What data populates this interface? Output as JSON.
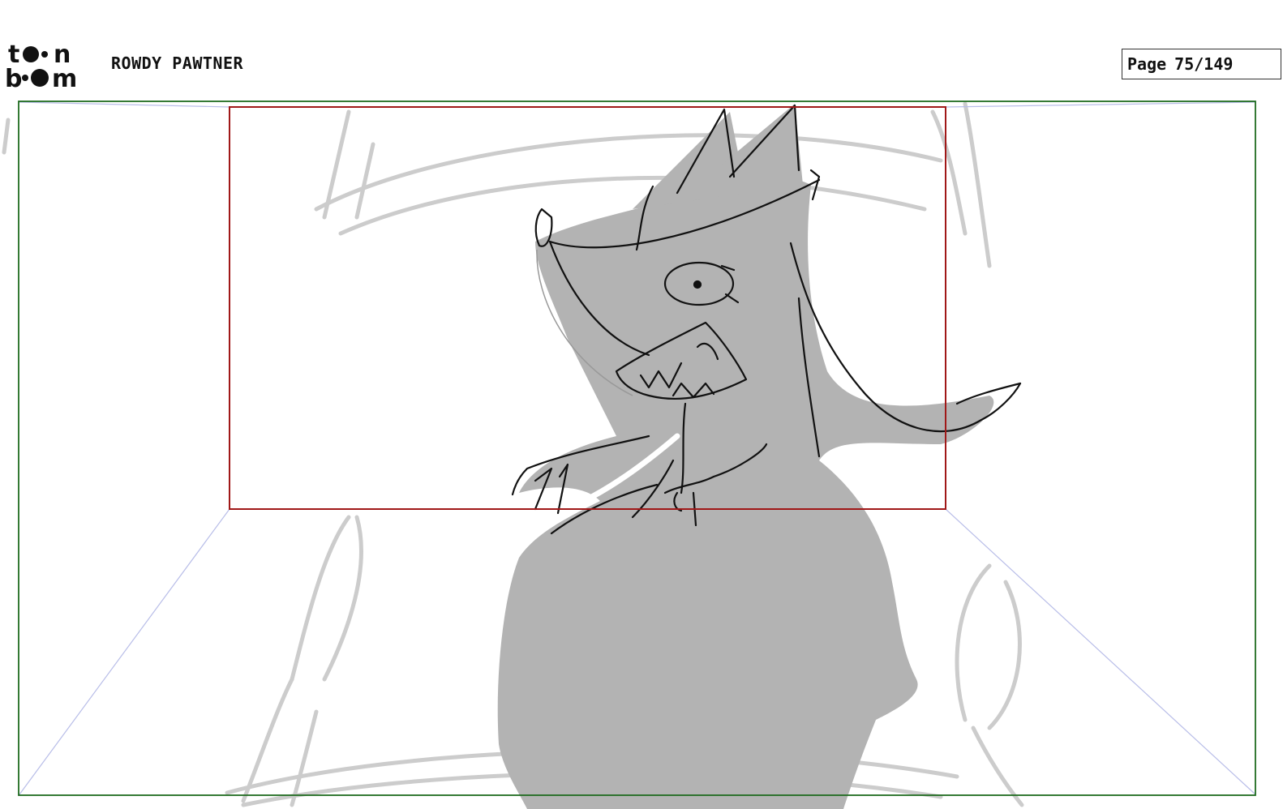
{
  "header": {
    "logo": {
      "line1": "t●●n",
      "line2": "b●●m",
      "icon": "toonboom-logo"
    },
    "project_title": "ROWDY PAWTNER",
    "page": {
      "label": "Page",
      "number": "75/149"
    }
  },
  "panel": {
    "colors": {
      "camera_frame": "#1f6b1f",
      "safe_frame": "#a01818",
      "perspective_guides": "#b8bde8",
      "sketch_gray": "#b3b3b3",
      "background_sketch": "#cccccc",
      "lines": "#111111"
    },
    "content": "storyboard-sketch-character"
  }
}
